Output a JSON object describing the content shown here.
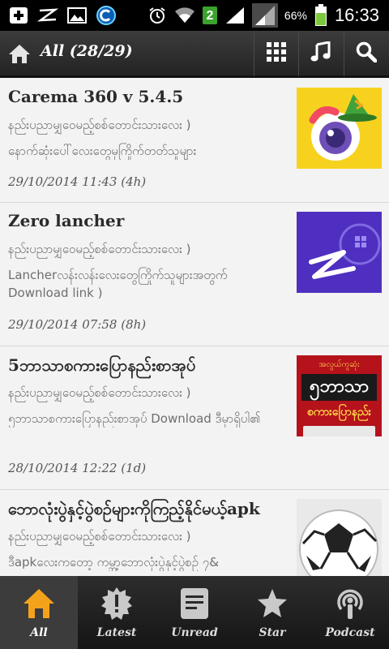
{
  "status_bar": {
    "battery_percent": "66%",
    "time": "16:33",
    "sim_badge": "2",
    "icons": [
      "add-box-icon",
      "z-app-icon",
      "image-icon",
      "cm-app-icon",
      "alarm-icon",
      "wifi-icon",
      "sim2-icon",
      "signal-icon",
      "signal-2-icon",
      "battery-icon"
    ]
  },
  "action_bar": {
    "title": "All (28/29)",
    "icons": [
      "home-icon",
      "grid-icon",
      "music-icon",
      "search-icon"
    ]
  },
  "feed": [
    {
      "title": "Carema 360 v 5.4.5",
      "source": "နည်းပညာမျှဝေမည့်စစ်တောင်းသားလေး )",
      "description": "နောက်ဆုံးပေါ်လေးတွေမှကြိုက်တတ်သူများ",
      "date": "29/10/2014 11:43 (4h)"
    },
    {
      "title": "Zero lancher",
      "source": "နည်းပညာမျှဝေမည့်စစ်တောင်းသားလေး )",
      "description": "Lancherလန်းလန်းလေးတွေကြိုက်သူများအတွက် Download link  )",
      "date": "29/10/2014 07:58 (8h)"
    },
    {
      "title": "5ဘာသာစကားပြောနည်းစာအုပ်",
      "source": "နည်းပညာမျှဝေမည့်စစ်တောင်းသားလေး )",
      "description": "၅ဘာသာစကားပြောနည်းစာအုပ် Download ဒီမှာရှိပါ၏",
      "date": "28/10/2014 12:22 (1d)"
    },
    {
      "title": "ဘောလုံးပွဲနှင့်ပွဲစဉ်များကိုကြည့်နိုင်မယ့်apk",
      "source": "နည်းပညာမျှဝေမည့်စစ်တောင်းသားလေး )",
      "description": "ဒီapkလေးကတော့ ကမ္ဘာ့ဘောလုံးပွဲနှင့်ပွဲစဉ် ၇&",
      "date": ""
    }
  ],
  "thumbnails": [
    {
      "icon": "camera360-app-icon",
      "bg": "#f6d21f"
    },
    {
      "icon": "zero-launcher-app-icon",
      "bg": "#4f2fc0"
    },
    {
      "icon": "myanmar-book-cover-icon",
      "bg": "#b5121b",
      "lines": [
        "အလွယ်ကူဆုံး",
        "၅ဘာသာ",
        "စကားပြောနည်း"
      ]
    },
    {
      "icon": "soccer-ball-icon",
      "bg": "#ffffff"
    }
  ],
  "tab_bar": {
    "tabs": [
      {
        "label": "All",
        "icon": "home-icon",
        "active": true
      },
      {
        "label": "Latest",
        "icon": "new-badge-icon",
        "active": false
      },
      {
        "label": "Unread",
        "icon": "document-icon",
        "active": false
      },
      {
        "label": "Star",
        "icon": "star-icon",
        "active": false
      },
      {
        "label": "Podcast",
        "icon": "podcast-icon",
        "active": false
      }
    ],
    "accent": "#f5a21b"
  }
}
